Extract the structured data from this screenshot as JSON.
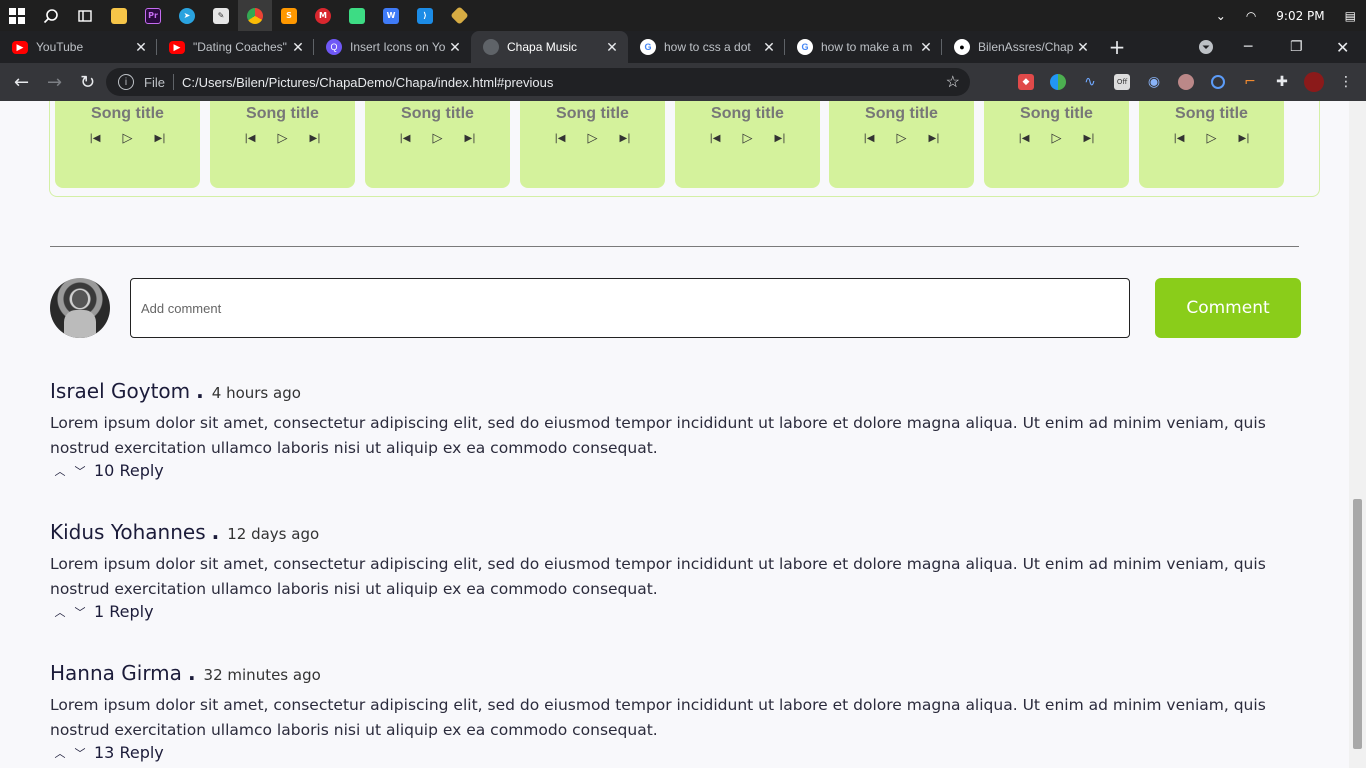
{
  "taskbar": {
    "apps": [
      "windows-logo",
      "search",
      "task-view",
      "file-explorer",
      "premiere-pro",
      "telegram",
      "vs-installer",
      "chrome",
      "sublime-text",
      "mega",
      "android-studio",
      "wps",
      "vscode",
      "git"
    ],
    "time": "9:02 PM"
  },
  "tabs": [
    {
      "title": "YouTube",
      "favicon_color": "#ff0000",
      "active": false
    },
    {
      "title": "\"Dating Coaches\"",
      "favicon_color": "#ff0000",
      "active": false
    },
    {
      "title": "Insert Icons on Yo",
      "favicon_color": "#6f58f6",
      "active": false
    },
    {
      "title": "Chapa Music",
      "favicon_color": "#5f6368",
      "active": true
    },
    {
      "title": "how to css a dot",
      "favicon_color": "#ffffff",
      "active": false
    },
    {
      "title": "how to make a m",
      "favicon_color": "#ffffff",
      "active": false
    },
    {
      "title": "BilenAssres/Chap",
      "favicon_color": "#ffffff",
      "active": false
    }
  ],
  "toolbar": {
    "scheme": "File",
    "url": "C:/Users/Bilen/Pictures/ChapaDemo/Chapa/index.html#previous"
  },
  "songs": {
    "title": "Song title",
    "cards": 8
  },
  "comment_form": {
    "placeholder": "Add comment",
    "button_label": "Comment"
  },
  "comments": [
    {
      "author": "Israel Goytom",
      "time": "4 hours ago",
      "text": "Lorem ipsum dolor sit amet, consectetur adipiscing elit, sed do eiusmod tempor incididunt ut labore et dolore magna aliqua. Ut enim ad minim veniam, quis nostrud exercitation ullamco laboris nisi ut aliquip ex ea commodo consequat.",
      "reply_label": "10 Reply"
    },
    {
      "author": "Kidus Yohannes",
      "time": "12 days ago",
      "text": "Lorem ipsum dolor sit amet, consectetur adipiscing elit, sed do eiusmod tempor incididunt ut labore et dolore magna aliqua. Ut enim ad minim veniam, quis nostrud exercitation ullamco laboris nisi ut aliquip ex ea commodo consequat.",
      "reply_label": "1 Reply"
    },
    {
      "author": "Hanna Girma",
      "time": "32 minutes ago",
      "text": "Lorem ipsum dolor sit amet, consectetur adipiscing elit, sed do eiusmod tempor incididunt ut labore et dolore magna aliqua. Ut enim ad minim veniam, quis nostrud exercitation ullamco laboris nisi ut aliquip ex ea commodo consequat.",
      "reply_label": "13 Reply"
    }
  ],
  "colors": {
    "accent": "#8acd1a",
    "card": "#d4f29c",
    "text": "#1c1c3a"
  }
}
